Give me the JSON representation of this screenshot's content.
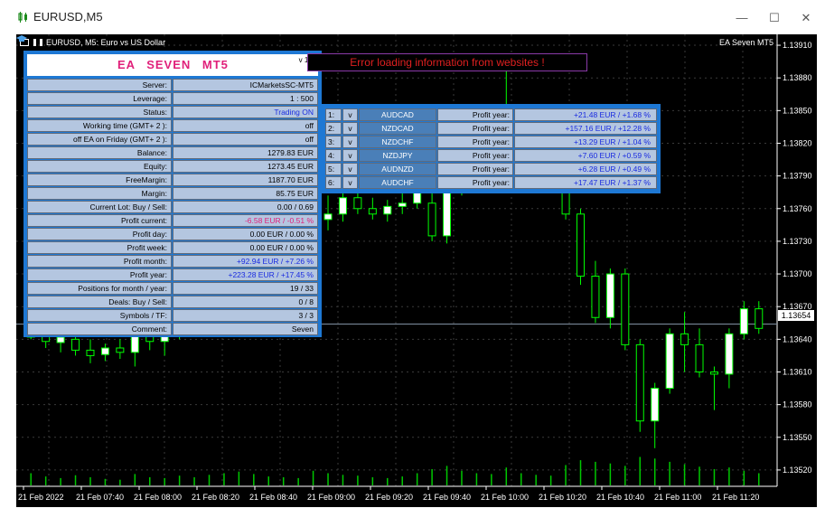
{
  "window": {
    "title": "EURUSD,M5",
    "minimize_glyph": "—",
    "maximize_glyph": "☐",
    "close_glyph": "✕"
  },
  "chart": {
    "symbol_label": "EURUSD, M5:  Euro vs US Dollar",
    "ea_label": "EA Seven MT5",
    "current_price": "1.13654",
    "colors": {
      "background": "#000000",
      "bull_body": "#ffffff",
      "wick": "#00ff00",
      "volume": "#00c800",
      "bid_line": "#7f8fa0",
      "panel_border": "#1e78d4"
    }
  },
  "chart_data": {
    "type": "candlestick",
    "title": "",
    "ylim": [
      1.13505,
      1.1392
    ],
    "y_ticks": [
      "1.13910",
      "1.13880",
      "1.13850",
      "1.13820",
      "1.13790",
      "1.13760",
      "1.13730",
      "1.13700",
      "1.13670",
      "1.13640",
      "1.13610",
      "1.13580",
      "1.13550",
      "1.13520"
    ],
    "x_ticks": [
      "21 Feb 2022",
      "21 Feb 07:40",
      "21 Feb 08:00",
      "21 Feb 08:20",
      "21 Feb 08:40",
      "21 Feb 09:00",
      "21 Feb 09:20",
      "21 Feb 09:40",
      "21 Feb 10:00",
      "21 Feb 10:20",
      "21 Feb 10:40",
      "21 Feb 11:00",
      "21 Feb 11:20"
    ],
    "candles": [
      {
        "o": 1.1366,
        "h": 1.13672,
        "l": 1.1364,
        "c": 1.13642
      },
      {
        "o": 1.13643,
        "h": 1.13655,
        "l": 1.13632,
        "c": 1.13638
      },
      {
        "o": 1.13637,
        "h": 1.13645,
        "l": 1.13628,
        "c": 1.13642
      },
      {
        "o": 1.1364,
        "h": 1.13646,
        "l": 1.13625,
        "c": 1.1363
      },
      {
        "o": 1.1363,
        "h": 1.1364,
        "l": 1.13618,
        "c": 1.13625
      },
      {
        "o": 1.13626,
        "h": 1.13636,
        "l": 1.1362,
        "c": 1.13632
      },
      {
        "o": 1.13632,
        "h": 1.1364,
        "l": 1.13622,
        "c": 1.13628
      },
      {
        "o": 1.13628,
        "h": 1.13648,
        "l": 1.13615,
        "c": 1.13643
      },
      {
        "o": 1.13643,
        "h": 1.1366,
        "l": 1.1363,
        "c": 1.13638
      },
      {
        "o": 1.13638,
        "h": 1.13662,
        "l": 1.13625,
        "c": 1.13655
      },
      {
        "o": 1.13655,
        "h": 1.1367,
        "l": 1.1364,
        "c": 1.1366
      },
      {
        "o": 1.1366,
        "h": 1.1368,
        "l": 1.1365,
        "c": 1.1367
      },
      {
        "o": 1.1367,
        "h": 1.1369,
        "l": 1.1366,
        "c": 1.13685
      },
      {
        "o": 1.13685,
        "h": 1.13712,
        "l": 1.1367,
        "c": 1.13705
      },
      {
        "o": 1.13705,
        "h": 1.1373,
        "l": 1.13695,
        "c": 1.1372
      },
      {
        "o": 1.1372,
        "h": 1.13745,
        "l": 1.13708,
        "c": 1.1374
      },
      {
        "o": 1.1374,
        "h": 1.13752,
        "l": 1.13722,
        "c": 1.1373
      },
      {
        "o": 1.1373,
        "h": 1.13742,
        "l": 1.13712,
        "c": 1.13722
      },
      {
        "o": 1.13722,
        "h": 1.13735,
        "l": 1.13712,
        "c": 1.1372
      },
      {
        "o": 1.1372,
        "h": 1.1376,
        "l": 1.13715,
        "c": 1.1375
      },
      {
        "o": 1.1375,
        "h": 1.13772,
        "l": 1.1374,
        "c": 1.13755
      },
      {
        "o": 1.13755,
        "h": 1.13775,
        "l": 1.13748,
        "c": 1.1377
      },
      {
        "o": 1.1377,
        "h": 1.13782,
        "l": 1.13755,
        "c": 1.1376
      },
      {
        "o": 1.1376,
        "h": 1.1377,
        "l": 1.1375,
        "c": 1.13755
      },
      {
        "o": 1.13755,
        "h": 1.13768,
        "l": 1.13748,
        "c": 1.13762
      },
      {
        "o": 1.13762,
        "h": 1.13775,
        "l": 1.13755,
        "c": 1.13765
      },
      {
        "o": 1.13765,
        "h": 1.1379,
        "l": 1.1376,
        "c": 1.13785
      },
      {
        "o": 1.13765,
        "h": 1.1379,
        "l": 1.1373,
        "c": 1.13735
      },
      {
        "o": 1.13735,
        "h": 1.1379,
        "l": 1.13728,
        "c": 1.1378
      },
      {
        "o": 1.1378,
        "h": 1.13792,
        "l": 1.13772,
        "c": 1.13785
      },
      {
        "o": 1.13785,
        "h": 1.138,
        "l": 1.13775,
        "c": 1.13792
      },
      {
        "o": 1.13792,
        "h": 1.13808,
        "l": 1.13782,
        "c": 1.13798
      },
      {
        "o": 1.13798,
        "h": 1.1389,
        "l": 1.1379,
        "c": 1.1381
      },
      {
        "o": 1.1381,
        "h": 1.13825,
        "l": 1.1379,
        "c": 1.138
      },
      {
        "o": 1.138,
        "h": 1.13815,
        "l": 1.13785,
        "c": 1.13808
      },
      {
        "o": 1.13808,
        "h": 1.13822,
        "l": 1.13795,
        "c": 1.13815
      },
      {
        "o": 1.13805,
        "h": 1.13815,
        "l": 1.1375,
        "c": 1.13755
      },
      {
        "o": 1.13755,
        "h": 1.1376,
        "l": 1.1369,
        "c": 1.13698
      },
      {
        "o": 1.13698,
        "h": 1.13712,
        "l": 1.13655,
        "c": 1.1366
      },
      {
        "o": 1.1366,
        "h": 1.13705,
        "l": 1.1365,
        "c": 1.137
      },
      {
        "o": 1.137,
        "h": 1.13705,
        "l": 1.1363,
        "c": 1.13635
      },
      {
        "o": 1.13635,
        "h": 1.1364,
        "l": 1.13555,
        "c": 1.13565
      },
      {
        "o": 1.13565,
        "h": 1.136,
        "l": 1.1354,
        "c": 1.13595
      },
      {
        "o": 1.13595,
        "h": 1.1365,
        "l": 1.1359,
        "c": 1.13645
      },
      {
        "o": 1.13645,
        "h": 1.13665,
        "l": 1.1361,
        "c": 1.13635
      },
      {
        "o": 1.13635,
        "h": 1.1365,
        "l": 1.13605,
        "c": 1.1361
      },
      {
        "o": 1.1361,
        "h": 1.13615,
        "l": 1.13575,
        "c": 1.13608
      },
      {
        "o": 1.13608,
        "h": 1.1365,
        "l": 1.13595,
        "c": 1.13645
      },
      {
        "o": 1.13645,
        "h": 1.13675,
        "l": 1.1364,
        "c": 1.13668
      },
      {
        "o": 1.13668,
        "h": 1.13675,
        "l": 1.13645,
        "c": 1.1365
      }
    ],
    "volumes": [
      30,
      22,
      18,
      25,
      20,
      16,
      14,
      28,
      20,
      18,
      24,
      20,
      26,
      30,
      34,
      28,
      22,
      20,
      18,
      36,
      30,
      26,
      24,
      20,
      18,
      22,
      30,
      40,
      48,
      36,
      30,
      28,
      44,
      30,
      26,
      24,
      50,
      62,
      58,
      54,
      48,
      70,
      66,
      58,
      52,
      46,
      40,
      44,
      36,
      30
    ]
  },
  "panel": {
    "title": "EA   SEVEN   MT5",
    "version": "v 1.6",
    "rows": [
      {
        "label": "Server:",
        "value": "ICMarketsSC-MT5"
      },
      {
        "label": "Leverage:",
        "value": "1 : 500"
      },
      {
        "label": "Status:",
        "value": "Trading ON"
      },
      {
        "label": "Working time (GMT+ 2 ):",
        "value": "off"
      },
      {
        "label": "off EA on Friday (GMT+ 2 ):",
        "value": "off"
      },
      {
        "label": "Balance:",
        "value": "1279.83  EUR"
      },
      {
        "label": "Equity:",
        "value": "1273.45  EUR"
      },
      {
        "label": "FreeMargin:",
        "value": "1187.70  EUR"
      },
      {
        "label": "Margin:",
        "value": "85.75  EUR"
      },
      {
        "label": "Current Lot:  Buy  /  Sell:",
        "value": "0.00   /   0.69"
      },
      {
        "label": "Profit current:",
        "value": "-6.58  EUR  /  -0.51  %"
      },
      {
        "label": "Profit day:",
        "value": "0.00  EUR  /  0.00  %"
      },
      {
        "label": "Profit week:",
        "value": "0.00  EUR  /  0.00  %"
      },
      {
        "label": "Profit month:",
        "value": "+92.94  EUR  /  +7.26  %"
      },
      {
        "label": "Profit year:",
        "value": "+223.28  EUR  /  +17.45  %"
      },
      {
        "label": "Positions for month / year:",
        "value": "19   /   33"
      },
      {
        "label": "Deals:  Buy  /  Sell:",
        "value": "0   /   8"
      },
      {
        "label": "Symbols  /  TF:",
        "value": "3   /   3"
      },
      {
        "label": "Comment:",
        "value": "Seven"
      }
    ]
  },
  "error_message": "Error loading information from websites !",
  "symbols": [
    {
      "num": "1:",
      "flag": "v",
      "pair": "AUDCAD",
      "label": "Profit year:",
      "value": "+21.48  EUR  /  +1.68  %"
    },
    {
      "num": "2:",
      "flag": "v",
      "pair": "NZDCAD",
      "label": "Profit year:",
      "value": "+157.16  EUR  /  +12.28  %"
    },
    {
      "num": "3:",
      "flag": "v",
      "pair": "NZDCHF",
      "label": "Profit year:",
      "value": "+13.29  EUR  /  +1.04  %"
    },
    {
      "num": "4:",
      "flag": "v",
      "pair": "NZDJPY",
      "label": "Profit year:",
      "value": "+7.60  EUR  /  +0.59  %"
    },
    {
      "num": "5:",
      "flag": "v",
      "pair": "AUDNZD",
      "label": "Profit year:",
      "value": "+6.28  EUR  /  +0.49  %"
    },
    {
      "num": "6:",
      "flag": "v",
      "pair": "AUDCHF",
      "label": "Profit year:",
      "value": "+17.47  EUR  /  +1.37  %"
    }
  ]
}
